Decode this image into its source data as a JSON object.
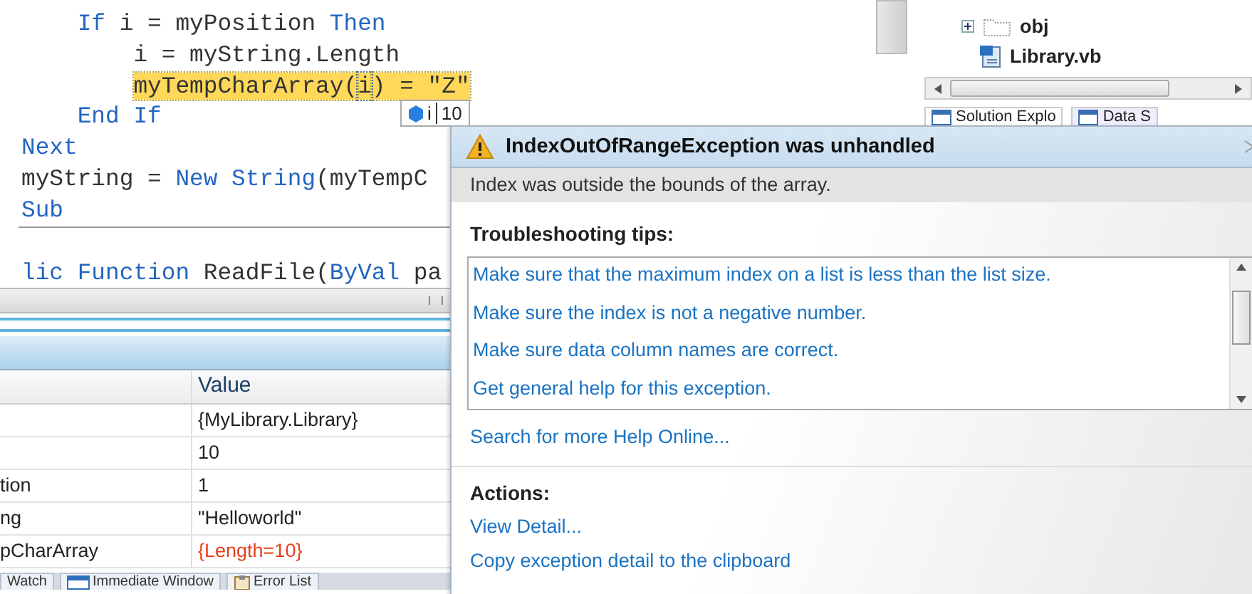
{
  "editor": {
    "lines": [
      {
        "kind": "block",
        "tokens": [
          {
            "text": "If",
            "kind": "kw"
          },
          {
            "text": "i = myPosition",
            "kind": "id"
          },
          {
            "text": "Then",
            "kind": "kw"
          }
        ]
      },
      {
        "kind": "nested",
        "tokens": [
          {
            "text": "i = myString.Length",
            "kind": "id"
          }
        ]
      },
      {
        "kind": "nested",
        "tokens": [
          {
            "text": "myTempCharArray(",
            "kind": "hl"
          },
          {
            "text": "i",
            "kind": "hover"
          },
          {
            "text": ") = \"Z\"",
            "kind": "hl"
          }
        ]
      },
      {
        "kind": "block",
        "tokens": [
          {
            "text": "End If",
            "kind": "kw"
          }
        ]
      },
      {
        "kind": "top",
        "tokens": [
          {
            "text": "Next",
            "kind": "kw"
          }
        ]
      },
      {
        "kind": "top",
        "tokens": [
          {
            "text": "myString =",
            "kind": "id"
          },
          {
            "text": "New String",
            "kind": "kw"
          },
          {
            "text": "(myTempC",
            "kind": "id"
          }
        ]
      },
      {
        "kind": "top",
        "tokens": [
          {
            "text": "Sub",
            "kind": "kw"
          }
        ]
      },
      {
        "kind": "separator"
      },
      {
        "kind": "top",
        "tokens": [
          {
            "text": "lic Function",
            "kind": "kw"
          },
          {
            "text": "ReadFile(",
            "kind": "id"
          },
          {
            "text": "ByVal",
            "kind": "kw"
          },
          {
            "text": "pa",
            "kind": "id"
          }
        ]
      }
    ]
  },
  "data_tip": {
    "name": "i",
    "value": "10"
  },
  "solution_explorer": {
    "tree": [
      {
        "label": "obj",
        "kind": "folder",
        "expanded": false
      },
      {
        "label": "Library.vb",
        "kind": "file"
      }
    ],
    "tabs": [
      {
        "label": "Solution Explo",
        "selected": true
      },
      {
        "label": "Data S",
        "selected": false
      }
    ]
  },
  "locals": {
    "columns": [
      "Value"
    ],
    "rows": [
      {
        "value": "{MyLibrary.Library}",
        "changed": false
      },
      {
        "value": "10",
        "changed": false
      },
      {
        "name": "tion",
        "value": "1",
        "changed": false
      },
      {
        "name": "ng",
        "value": "\"Helloworld\"",
        "changed": false
      },
      {
        "name": "pCharArray",
        "value": "{Length=10}",
        "changed": true
      }
    ]
  },
  "bottom_tabs": [
    {
      "label": "Watch",
      "kind": "plain"
    },
    {
      "label": "Immediate Window",
      "kind": "window"
    },
    {
      "label": "Error List",
      "kind": "clipboard"
    }
  ],
  "exception": {
    "title": "IndexOutOfRangeException was unhandled",
    "message": "Index was outside the bounds of the array.",
    "tips_heading": "Troubleshooting tips:",
    "tips": [
      "Make sure that the maximum index on a list is less than the list size.",
      "Make sure the index is not a negative number.",
      "Make sure data column names are correct.",
      "Get general help for this exception."
    ],
    "help_link": "Search for more Help Online...",
    "actions_heading": "Actions:",
    "actions": [
      "View Detail...",
      "Copy exception detail to the clipboard"
    ]
  }
}
